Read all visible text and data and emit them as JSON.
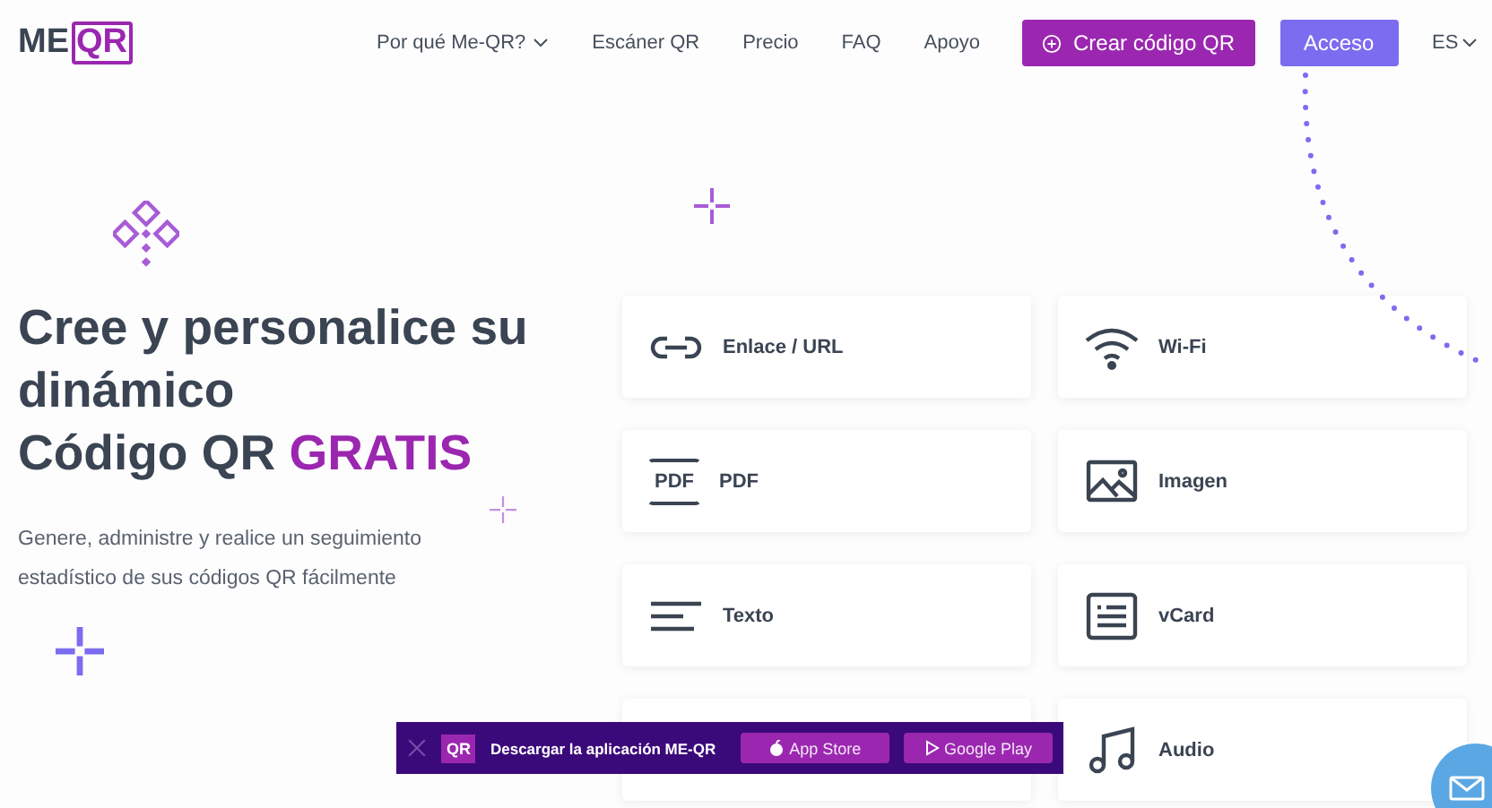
{
  "logo": {
    "part_1": "ME",
    "part_2": "QR"
  },
  "nav": [
    {
      "label": "Por qué Me-QR?",
      "dropdown": true
    },
    {
      "label": "Escáner QR",
      "dropdown": false
    },
    {
      "label": "Precio",
      "dropdown": false
    },
    {
      "label": "FAQ",
      "dropdown": false
    },
    {
      "label": "Apoyo",
      "dropdown": false
    }
  ],
  "create_button": "Crear código QR",
  "login_button": "Acceso",
  "language": "ES",
  "hero": {
    "title": "Cree y personalice su dinámico",
    "title_2": "Código QR",
    "title_highlight": "GRATIS",
    "subtitle": "Genere, administre y realice un seguimiento estadístico de sus códigos QR fácilmente"
  },
  "cards": [
    {
      "label": "Enlace / URL"
    },
    {
      "label": "Wi-Fi"
    },
    {
      "label": "PDF",
      "icon_text": "PDF"
    },
    {
      "label": "Imagen"
    },
    {
      "label": "Texto"
    },
    {
      "label": "vCard"
    },
    {
      "label": "Audio"
    }
  ],
  "app_banner": {
    "badge": "QR",
    "text": "Descargar la aplicación ME-QR",
    "buttons": [
      {
        "label": "App Store",
        "kind": "apple"
      },
      {
        "label": "Google Play",
        "kind": "play"
      }
    ]
  }
}
